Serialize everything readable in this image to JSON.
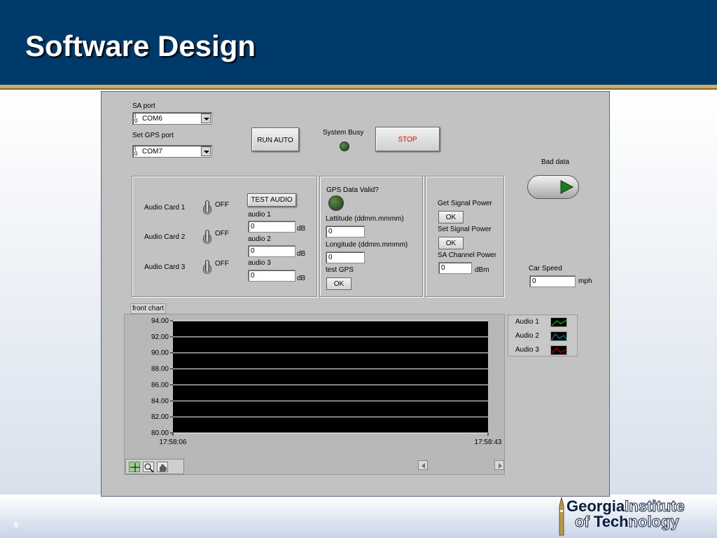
{
  "slide": {
    "title": "Software Design",
    "page_number": "5",
    "logo_line1_a": "Georgia",
    "logo_line1_b": "Institute",
    "logo_line2_a": "of ",
    "logo_line2_b": "Tech",
    "logo_line2_c": "nology"
  },
  "panel": {
    "sa_port_label": "SA port",
    "sa_port_value": "COM6",
    "gps_port_label": "Set GPS port",
    "gps_port_value": "COM7",
    "io_glyph": "I/O",
    "run_auto_label": "RUN AUTO",
    "system_busy_label": "System Busy",
    "stop_label": "STOP",
    "bad_data_label": "Bad data",
    "audio_section": {
      "cards": [
        {
          "label": "Audio Card 1",
          "state": "OFF"
        },
        {
          "label": "Audio Card 2",
          "state": "OFF"
        },
        {
          "label": "Audio Card 3",
          "state": "OFF"
        }
      ],
      "test_audio_label": "TEST AUDIO",
      "readings": [
        {
          "label": "audio 1",
          "value": "0",
          "unit": "dB"
        },
        {
          "label": "audio 2",
          "value": "0",
          "unit": "dB"
        },
        {
          "label": "audio 3",
          "value": "0",
          "unit": "dB"
        }
      ]
    },
    "gps_section": {
      "valid_label": "GPS Data Valid?",
      "latitude_label": "Lattitude (ddmm.mmmm)",
      "latitude_value": "0",
      "longitude_label": "Longitude (ddmm.mmmm)",
      "longitude_value": "0",
      "test_gps_label": "test GPS",
      "ok_label": "OK"
    },
    "signal_section": {
      "get_signal_label": "Get Signal Power",
      "get_ok": "OK",
      "set_signal_label": "Set Signal Power",
      "set_ok": "OK",
      "channel_power_label": "SA Channel Power",
      "channel_power_value": "0",
      "channel_power_unit": "dBm"
    },
    "car_speed_label": "Car Speed",
    "car_speed_value": "0",
    "car_speed_unit": "mph",
    "chart_label": "front chart"
  },
  "chart_data": {
    "type": "line",
    "y_ticks": [
      "94.00",
      "92.00",
      "90.00",
      "88.00",
      "86.00",
      "84.00",
      "82.00",
      "80.00"
    ],
    "ylim": [
      80,
      94
    ],
    "x_ticks": [
      "17:58:06",
      "17:58:43"
    ],
    "series": [
      {
        "name": "Audio 1",
        "values": [],
        "color": "#00cc00"
      },
      {
        "name": "Audio 2",
        "values": [],
        "color": "#00cccc"
      },
      {
        "name": "Audio 3",
        "values": [],
        "color": "#cc0000"
      }
    ],
    "plot_background": "#000000",
    "grid": true
  },
  "colors": {
    "header": "#003a6b",
    "gold": "#c9b063",
    "stop_text": "#e00000",
    "panel": "#c2c2c2"
  }
}
